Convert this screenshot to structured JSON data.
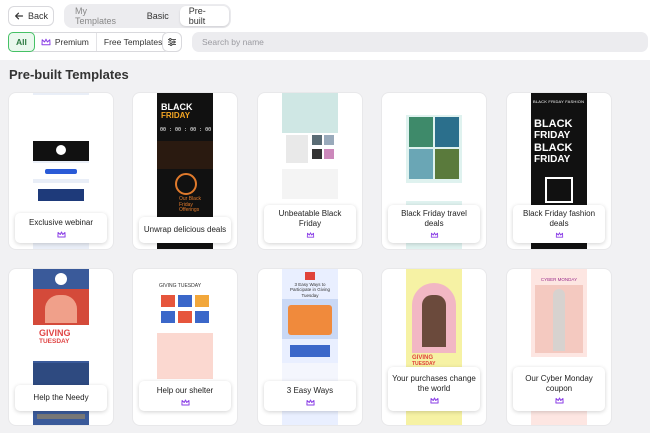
{
  "toolbar": {
    "back_label": "Back",
    "tabs": [
      {
        "label": "My Templates",
        "state": "inactive"
      },
      {
        "label": "Basic",
        "state": "inactive"
      },
      {
        "label": "Pre-built",
        "state": "active"
      }
    ]
  },
  "filters": {
    "all_label": "All",
    "premium_label": "Premium",
    "free_label": "Free Templates"
  },
  "search": {
    "placeholder": "Search by name",
    "value": ""
  },
  "section_title": "Pre-built Templates",
  "colors": {
    "accent_green": "#45c165",
    "premium_purple": "#8a3ee6"
  },
  "icons": {
    "back": "arrow-left-icon",
    "premium": "crown-icon",
    "settings": "sliders-icon"
  },
  "templates": [
    {
      "name": "Exclusive webinar",
      "premium": true
    },
    {
      "name": "Unwrap delicious deals",
      "premium": false
    },
    {
      "name": "Unbeatable Black Friday",
      "premium": true
    },
    {
      "name": "Black Friday travel deals",
      "premium": true
    },
    {
      "name": "Black Friday fashion deals",
      "premium": true
    },
    {
      "name": "Help the Needy",
      "premium": false
    },
    {
      "name": "Help our shelter",
      "premium": true
    },
    {
      "name": "3 Easy Ways",
      "premium": true
    },
    {
      "name": "Your purchases change the world",
      "premium": true
    },
    {
      "name": "Our Cyber Monday coupon",
      "premium": true
    }
  ],
  "thumb_text": {
    "black": "BLACK",
    "friday": "FRIDAY",
    "timer": "00 : 00 : 00 : 00",
    "our_black_friday": "Our Black Friday Offerings",
    "fashion_header": "BLACK FRIDAY FASHION",
    "giving": "GIVING",
    "tuesday": "TUESDAY",
    "giving_tues": "GIVING TUESDAY",
    "three_easy": "3 Easy Ways to Participate in Giving Tuesday",
    "cyber": "CYBER MONDAY"
  }
}
